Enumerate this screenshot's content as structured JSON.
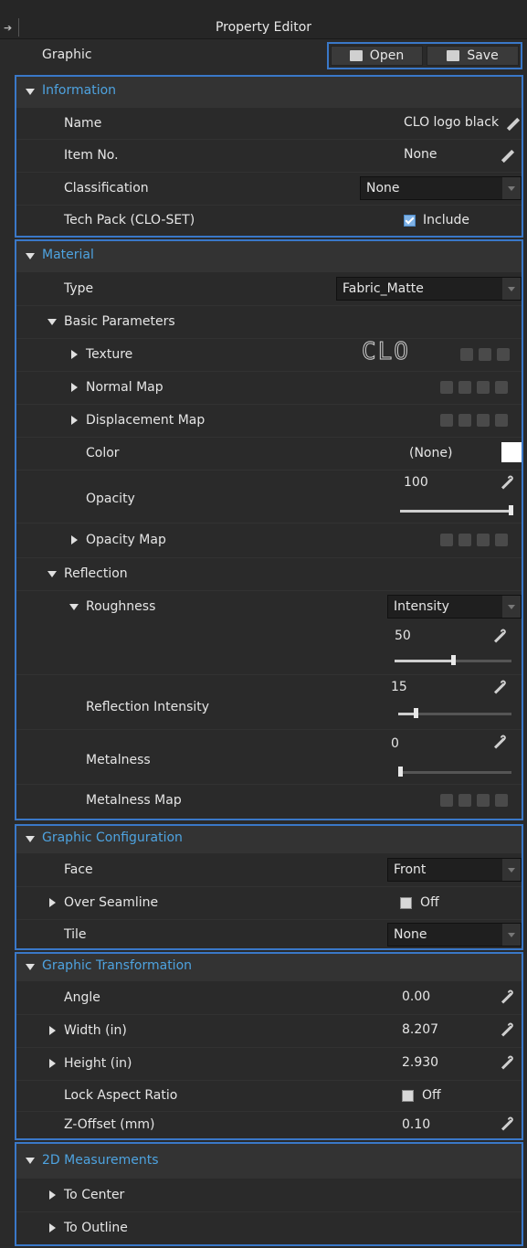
{
  "window": {
    "title": "Property Editor"
  },
  "header": {
    "label": "Graphic",
    "open_label": "Open",
    "save_label": "Save"
  },
  "information": {
    "title": "Information",
    "name_label": "Name",
    "name_value": "CLO logo black",
    "item_no_label": "Item No.",
    "item_no_value": "None",
    "classification_label": "Classification",
    "classification_value": "None",
    "techpack_label": "Tech Pack (CLO-SET)",
    "techpack_value": "Include",
    "techpack_checked": true
  },
  "material": {
    "title": "Material",
    "type_label": "Type",
    "type_value": "Fabric_Matte",
    "basic_parameters_label": "Basic Parameters",
    "texture_label": "Texture",
    "texture_thumb_text": "CLO",
    "normal_map_label": "Normal Map",
    "displacement_map_label": "Displacement Map",
    "color_label": "Color",
    "color_value": "(None)",
    "color_swatch": "#ffffff",
    "opacity_label": "Opacity",
    "opacity_value": "100",
    "opacity_level": 1.0,
    "opacity_map_label": "Opacity Map",
    "reflection_label": "Reflection",
    "roughness_label": "Roughness",
    "roughness_mode": "Intensity",
    "roughness_value": "50",
    "roughness_level": 0.5,
    "reflection_intensity_label": "Reflection Intensity",
    "reflection_intensity_value": "15",
    "reflection_intensity_level": 0.15,
    "metalness_label": "Metalness",
    "metalness_value": "0",
    "metalness_level": 0.0,
    "metalness_map_label": "Metalness Map"
  },
  "graphic_configuration": {
    "title": "Graphic Configuration",
    "face_label": "Face",
    "face_value": "Front",
    "over_seamline_label": "Over Seamline",
    "over_seamline_value": "Off",
    "tile_label": "Tile",
    "tile_value": "None"
  },
  "graphic_transformation": {
    "title": "Graphic Transformation",
    "angle_label": "Angle",
    "angle_value": "0.00",
    "width_label": "Width (in)",
    "width_value": "8.207",
    "height_label": "Height (in)",
    "height_value": "2.930",
    "lock_label": "Lock Aspect Ratio",
    "lock_value": "Off",
    "zoffset_label": "Z-Offset (mm)",
    "zoffset_value": "0.10"
  },
  "measurements": {
    "title": "2D Measurements",
    "to_center_label": "To Center",
    "to_outline_label": "To Outline"
  },
  "colors": {
    "accent": "#3a78c8",
    "section_title": "#4ea3e0",
    "background": "#2a2a2a"
  }
}
